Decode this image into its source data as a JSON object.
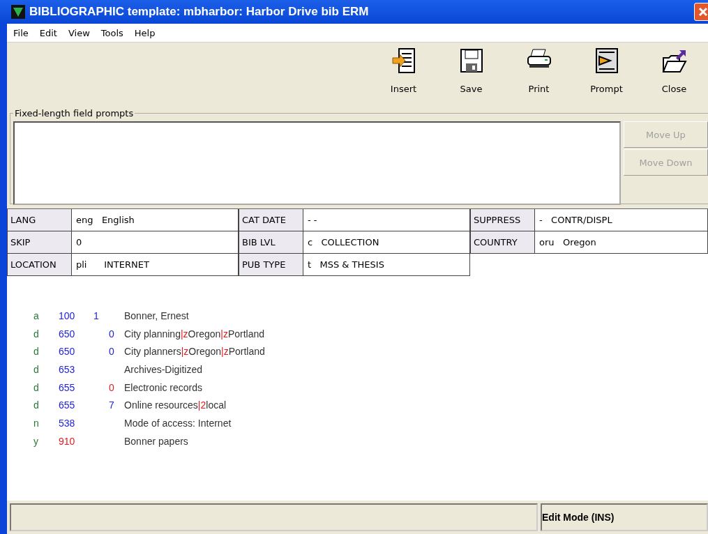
{
  "window": {
    "title": "BIBLIOGRAPHIC template: mbharbor: Harbor Drive bib ERM"
  },
  "menu": [
    "File",
    "Edit",
    "View",
    "Tools",
    "Help"
  ],
  "toolbar": [
    {
      "label": "Insert",
      "kind": "insert"
    },
    {
      "label": "Save",
      "kind": "save"
    },
    {
      "label": "Print",
      "kind": "print"
    },
    {
      "label": "Prompt",
      "kind": "prompt"
    },
    {
      "label": "Close",
      "kind": "close"
    }
  ],
  "prompts": {
    "legend": "Fixed-length field prompts",
    "buttons": [
      {
        "label": "Move Up",
        "disabled": true
      },
      {
        "label": "Move Down",
        "disabled": true
      }
    ]
  },
  "fixed_fields": [
    {
      "label": "LANG",
      "value": "eng   English"
    },
    {
      "label": "CAT DATE",
      "value": "- -"
    },
    {
      "label": "SUPPRESS",
      "value": "-   CONTR/DISPL"
    },
    {
      "label": "SKIP",
      "value": "0"
    },
    {
      "label": "BIB LVL",
      "value": "c   COLLECTION"
    },
    {
      "label": "COUNTRY",
      "value": "oru   Oregon"
    },
    {
      "label": "LOCATION",
      "value": "pli      INTERNET"
    },
    {
      "label": "PUB TYPE",
      "value": "t   MSS & THESIS"
    }
  ],
  "var_fields": [
    {
      "field_tag": "a",
      "marc": "100",
      "marc_highlight": false,
      "ind1": "1",
      "ind_highlight": false,
      "parts": [
        {
          "text": "Bonner, Ernest",
          "delimiter": false
        }
      ]
    },
    {
      "field_tag": "d",
      "marc": "650",
      "marc_highlight": false,
      "ind2": "0",
      "ind_highlight": false,
      "parts": [
        {
          "text": "City planning",
          "delimiter": false
        },
        {
          "text": "|z",
          "delimiter": true
        },
        {
          "text": "Oregon",
          "delimiter": false
        },
        {
          "text": "|z",
          "delimiter": true
        },
        {
          "text": "Portland",
          "delimiter": false
        }
      ]
    },
    {
      "field_tag": "d",
      "marc": "650",
      "marc_highlight": false,
      "ind2": "0",
      "ind_highlight": false,
      "parts": [
        {
          "text": "City planners",
          "delimiter": false
        },
        {
          "text": "|z",
          "delimiter": true
        },
        {
          "text": "Oregon",
          "delimiter": false
        },
        {
          "text": "|z",
          "delimiter": true
        },
        {
          "text": "Portland",
          "delimiter": false
        }
      ]
    },
    {
      "field_tag": "d",
      "marc": "653",
      "marc_highlight": false,
      "parts": [
        {
          "text": "Archives-Digitized",
          "delimiter": false
        }
      ]
    },
    {
      "field_tag": "d",
      "marc": "655",
      "marc_highlight": false,
      "ind2": "0",
      "ind_highlight": true,
      "parts": [
        {
          "text": "Electronic records",
          "delimiter": false
        }
      ]
    },
    {
      "field_tag": "d",
      "marc": "655",
      "marc_highlight": false,
      "ind2": "7",
      "ind_highlight": false,
      "parts": [
        {
          "text": "Online resources",
          "delimiter": false
        },
        {
          "text": "|2",
          "delimiter": true
        },
        {
          "text": "local",
          "delimiter": false
        }
      ]
    },
    {
      "field_tag": "n",
      "marc": "538",
      "marc_highlight": false,
      "parts": [
        {
          "text": "Mode of access: Internet",
          "delimiter": false
        }
      ]
    },
    {
      "field_tag": "y",
      "marc": "910",
      "marc_highlight": true,
      "parts": [
        {
          "text": "Bonner papers",
          "delimiter": false
        }
      ]
    }
  ],
  "status_bar": {
    "mode": "Edit Mode (INS)"
  }
}
